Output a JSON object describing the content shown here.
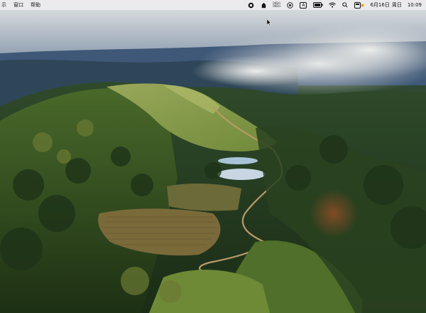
{
  "menubar": {
    "left_items": [
      "示",
      "窗口",
      "帮助"
    ],
    "network": {
      "up": "0KB/s",
      "down": "0KB/s"
    },
    "input_indicator": "A",
    "datetime": {
      "date": "6月16日",
      "weekday": "周日",
      "time": "10:09"
    }
  },
  "icons": [
    "record-icon",
    "app-icon",
    "network-speed",
    "play-icon",
    "input-method-icon",
    "battery-icon",
    "wifi-icon",
    "search-icon",
    "control-center-icon"
  ],
  "colors": {
    "menubar_bg": "#ececee",
    "accent": "#e0a020"
  }
}
